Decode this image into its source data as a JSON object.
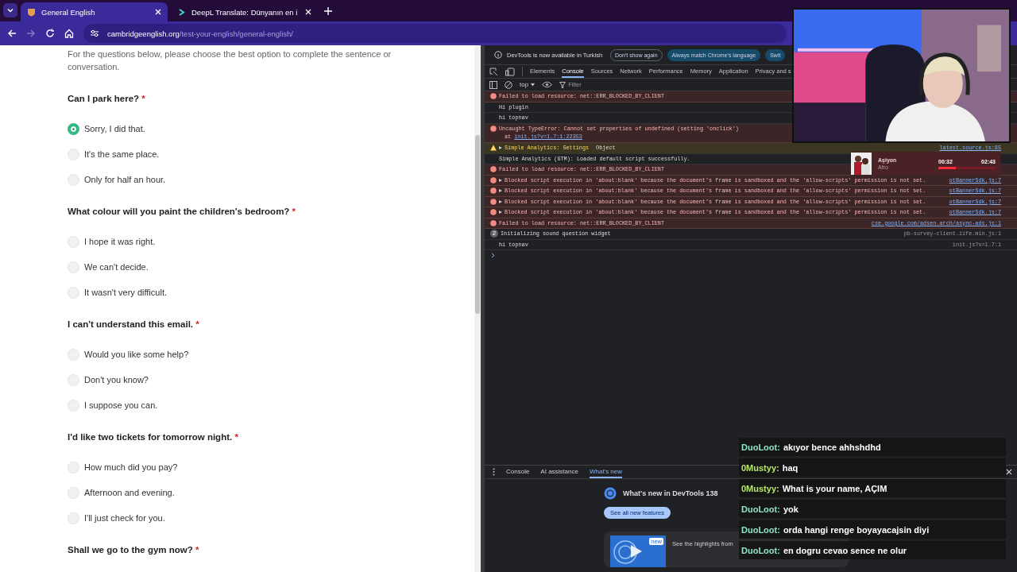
{
  "browser": {
    "tabs": [
      {
        "title": "General English",
        "selected": true
      },
      {
        "title": "DeepL Translate: Dünyanın en i",
        "selected": false
      }
    ],
    "url": {
      "domain": "cambridgeenglish.org",
      "path": "/test-your-english/general-english/"
    }
  },
  "page": {
    "intro": "For the questions below, please choose the best option to complete the sentence or conversation.",
    "questions": [
      {
        "text": "Can I park here?",
        "required_mark": "*",
        "options": [
          {
            "label": "Sorry, I did that.",
            "selected": true
          },
          {
            "label": "It's the same place.",
            "selected": false
          },
          {
            "label": "Only for half an hour.",
            "selected": false
          }
        ]
      },
      {
        "text": "What colour will you paint the children's bedroom?",
        "required_mark": "*",
        "options": [
          {
            "label": "I hope it was right.",
            "selected": false
          },
          {
            "label": "We can't decide.",
            "selected": false
          },
          {
            "label": "It wasn't very difficult.",
            "selected": false
          }
        ]
      },
      {
        "text": "I can't understand this email.",
        "required_mark": "*",
        "options": [
          {
            "label": "Would you like some help?",
            "selected": false
          },
          {
            "label": "Don't you know?",
            "selected": false
          },
          {
            "label": "I suppose you can.",
            "selected": false
          }
        ]
      },
      {
        "text": "I'd like two tickets for tomorrow night.",
        "required_mark": "*",
        "options": [
          {
            "label": "How much did you pay?",
            "selected": false
          },
          {
            "label": "Afternoon and evening.",
            "selected": false
          },
          {
            "label": "I'll just check for you.",
            "selected": false
          }
        ]
      },
      {
        "text": "Shall we go to the gym now?",
        "required_mark": "*"
      }
    ]
  },
  "devtools": {
    "notice": {
      "text": "DevTools is now available in Turkish",
      "buttons": [
        {
          "label": "Don't show again",
          "kind": "outline"
        },
        {
          "label": "Always match Chrome's language",
          "kind": "filled"
        },
        {
          "label": "Swit",
          "kind": "filled"
        }
      ]
    },
    "panels": [
      {
        "label": "Elements",
        "selected": false
      },
      {
        "label": "Console",
        "selected": true
      },
      {
        "label": "Sources",
        "selected": false
      },
      {
        "label": "Network",
        "selected": false
      },
      {
        "label": "Performance",
        "selected": false
      },
      {
        "label": "Memory",
        "selected": false
      },
      {
        "label": "Application",
        "selected": false
      },
      {
        "label": "Privacy and s",
        "selected": false
      }
    ],
    "toolbar": {
      "context": "top",
      "filter_placeholder": "Filter"
    },
    "console": [
      {
        "kind": "error",
        "text": "Failed to load resource: net::ERR_BLOCKED_BY_CLIENT"
      },
      {
        "kind": "log",
        "text": "Hi plugin"
      },
      {
        "kind": "log",
        "text": "hi topnav"
      },
      {
        "kind": "error",
        "text": "Uncaught TypeError: Cannot set properties of undefined (setting 'onclick')",
        "link_prefix": "at ",
        "link": "init.js?v=1.7:1:22353"
      },
      {
        "kind": "warning",
        "text": "Simple Analytics: Settings",
        "detail": "Object",
        "source": "latest.source.js:85"
      },
      {
        "kind": "log",
        "text": "Simple Analytics (GTM): Loaded default script successfully."
      },
      {
        "kind": "error",
        "text": "Failed to load resource: net::ERR_BLOCKED_BY_CLIENT"
      },
      {
        "kind": "error",
        "text": "Blocked script execution in 'about:blank' because the document's frame is sandboxed and the 'allow-scripts' permission is not set.",
        "source": "otBannerSdk.js:7"
      },
      {
        "kind": "error",
        "text": "Blocked script execution in 'about:blank' because the document's frame is sandboxed and the 'allow-scripts' permission is not set.",
        "source": "otBannerSdk.js:7"
      },
      {
        "kind": "error",
        "text": "Blocked script execution in 'about:blank' because the document's frame is sandboxed and the 'allow-scripts' permission is not set.",
        "source": "otBannerSdk.js:7"
      },
      {
        "kind": "error",
        "text": "Blocked script execution in 'about:blank' because the document's frame is sandboxed and the 'allow-scripts' permission is not set.",
        "source": "otBannerSdk.js:7"
      },
      {
        "kind": "error",
        "text": "Failed to load resource: net::ERR_BLOCKED_BY_CLIENT",
        "source": "cse.google.com/adsen.arch/async-ads.js:1"
      },
      {
        "kind": "count",
        "count": "2",
        "text": "Initializing sound question widget",
        "source": "pb-survey-client.iife.min.js:1"
      },
      {
        "kind": "log",
        "text": "hi topnav",
        "source": "init.js?v=1.7:1"
      }
    ],
    "drawer": {
      "tabs": [
        {
          "label": "Console",
          "selected": false
        },
        {
          "label": "AI assistance",
          "selected": false
        },
        {
          "label": "What's new",
          "selected": true
        }
      ],
      "title": "What's new in DevTools 138",
      "button": "See all new features",
      "badge": "new",
      "caption": "See the highlights from"
    }
  },
  "overlays": {
    "music": {
      "title": "Aşiyon",
      "artist": "Afro",
      "elapsed": "00:32",
      "total": "02:43",
      "level": 0.3
    },
    "chat": [
      {
        "user": "DuoLoot:",
        "message": "akıyor bence ahhshdhd",
        "color": "#8fe3c3"
      },
      {
        "user": "0Mustyy:",
        "message": "haq",
        "color": "#b5e86a"
      },
      {
        "user": "0Mustyy:",
        "message": "What is your name, AÇIM",
        "color": "#b5e86a"
      },
      {
        "user": "DuoLoot:",
        "message": "yok",
        "color": "#8fe3c3"
      },
      {
        "user": "DuoLoot:",
        "message": "orda hangi renge boyayacajsin diyi",
        "color": "#8fe3c3"
      },
      {
        "user": "DuoLoot:",
        "message": "en dogru cevao sence ne olur",
        "color": "#8fe3c3"
      }
    ]
  }
}
